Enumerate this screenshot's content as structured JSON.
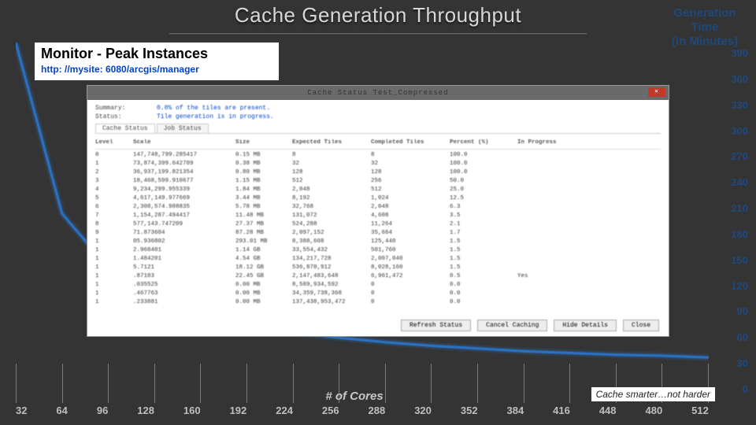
{
  "slide_title": "Cache Generation Throughput",
  "caption": {
    "heading": "Monitor - Peak Instances",
    "url": "http: //mysite: 6080/arcgis/manager"
  },
  "footer_note": "Cache smarter…not harder",
  "y_axis": {
    "title_l1": "Generation Time",
    "title_l2": "(in Minutes)",
    "ticks": [
      "390",
      "360",
      "330",
      "300",
      "270",
      "240",
      "210",
      "180",
      "150",
      "120",
      "90",
      "60",
      "30",
      "0"
    ]
  },
  "x_axis": {
    "title": "# of Cores",
    "ticks": [
      "32",
      "64",
      "96",
      "128",
      "160",
      "192",
      "224",
      "256",
      "288",
      "320",
      "352",
      "384",
      "416",
      "448",
      "480",
      "512"
    ]
  },
  "chart_data": {
    "type": "line",
    "title": "Cache Generation Throughput",
    "xlabel": "# of Cores",
    "ylabel": "Generation Time (in Minutes)",
    "xlim": [
      32,
      512
    ],
    "ylim": [
      0,
      390
    ],
    "series": [
      {
        "name": "Generation Time",
        "x": [
          32,
          64,
          96,
          128,
          160,
          192,
          224,
          256,
          288,
          320,
          352,
          384,
          416,
          448,
          480,
          512
        ],
        "y": [
          390,
          200,
          140,
          105,
          88,
          76,
          68,
          62,
          57,
          53,
          50,
          47,
          45,
          43,
          42,
          40
        ]
      }
    ]
  },
  "dialog": {
    "title": "Cache Status    Test_Compressed",
    "close_glyph": "✕",
    "summary_label": "Summary:",
    "summary_value": "0.0% of the tiles are present.",
    "status_label": "Status:",
    "status_value": "Tile generation is in progress.",
    "tabs": {
      "status": "Cache Status",
      "job": "Job Status"
    },
    "columns": [
      "Level",
      "Scale",
      "Size",
      "Expected Tiles",
      "Completed Tiles",
      "Percent (%)",
      "In Progress"
    ],
    "rows": [
      {
        "level": "0",
        "scale": "147,748,799.285417",
        "size": "0.15 MB",
        "expected": "8",
        "completed": "8",
        "percent": "100.0",
        "inprog": ""
      },
      {
        "level": "1",
        "scale": "73,874,399.642709",
        "size": "0.38 MB",
        "expected": "32",
        "completed": "32",
        "percent": "100.0",
        "inprog": ""
      },
      {
        "level": "2",
        "scale": "36,937,199.821354",
        "size": "0.80 MB",
        "expected": "128",
        "completed": "128",
        "percent": "100.0",
        "inprog": ""
      },
      {
        "level": "3",
        "scale": "18,468,599.910677",
        "size": "1.15 MB",
        "expected": "512",
        "completed": "256",
        "percent": "50.0",
        "inprog": ""
      },
      {
        "level": "4",
        "scale": "9,234,299.955339",
        "size": "1.84 MB",
        "expected": "2,048",
        "completed": "512",
        "percent": "25.0",
        "inprog": ""
      },
      {
        "level": "5",
        "scale": "4,617,149.977669",
        "size": "3.44 MB",
        "expected": "8,192",
        "completed": "1,024",
        "percent": "12.5",
        "inprog": ""
      },
      {
        "level": "6",
        "scale": "2,308,574.988835",
        "size": "5.78 MB",
        "expected": "32,768",
        "completed": "2,048",
        "percent": "6.3",
        "inprog": ""
      },
      {
        "level": "7",
        "scale": "1,154,287.494417",
        "size": "11.48 MB",
        "expected": "131,072",
        "completed": "4,608",
        "percent": "3.5",
        "inprog": ""
      },
      {
        "level": "8",
        "scale": "577,143.747209",
        "size": "27.37 MB",
        "expected": "524,288",
        "completed": "11,264",
        "percent": "2.1",
        "inprog": ""
      },
      {
        "level": "9",
        "scale": "71.873604",
        "size": "87.28 MB",
        "expected": "2,097,152",
        "completed": "35,664",
        "percent": "1.7",
        "inprog": ""
      },
      {
        "level": "1",
        "scale": "05.936802",
        "size": "293.01 MB",
        "expected": "8,388,608",
        "completed": "125,440",
        "percent": "1.5",
        "inprog": ""
      },
      {
        "level": "1",
        "scale": "2.968401",
        "size": "1.14 GB",
        "expected": "33,554,432",
        "completed": "501,760",
        "percent": "1.5",
        "inprog": ""
      },
      {
        "level": "1",
        "scale": "1.484201",
        "size": "4.54 GB",
        "expected": "134,217,728",
        "completed": "2,007,040",
        "percent": "1.5",
        "inprog": ""
      },
      {
        "level": "1",
        "scale": "5.7121",
        "size": "18.12 GB",
        "expected": "536,870,912",
        "completed": "8,028,160",
        "percent": "1.5",
        "inprog": ""
      },
      {
        "level": "1",
        "scale": ".87103",
        "size": "22.45 GB",
        "expected": "2,147,483,648",
        "completed": "6,961,472",
        "percent": "0.5",
        "inprog": "Yes"
      },
      {
        "level": "1",
        "scale": ".035525",
        "size": "0.00 MB",
        "expected": "8,589,934,592",
        "completed": "0",
        "percent": "0.0",
        "inprog": ""
      },
      {
        "level": "1",
        "scale": ".467763",
        "size": "0.00 MB",
        "expected": "34,359,738,368",
        "completed": "0",
        "percent": "0.0",
        "inprog": ""
      },
      {
        "level": "1",
        "scale": ".233881",
        "size": "0.00 MB",
        "expected": "137,438,953,472",
        "completed": "0",
        "percent": "0.0",
        "inprog": ""
      }
    ],
    "buttons": {
      "refresh": "Refresh Status",
      "cancel": "Cancel Caching",
      "hide": "Hide Details",
      "close": "Close"
    }
  }
}
